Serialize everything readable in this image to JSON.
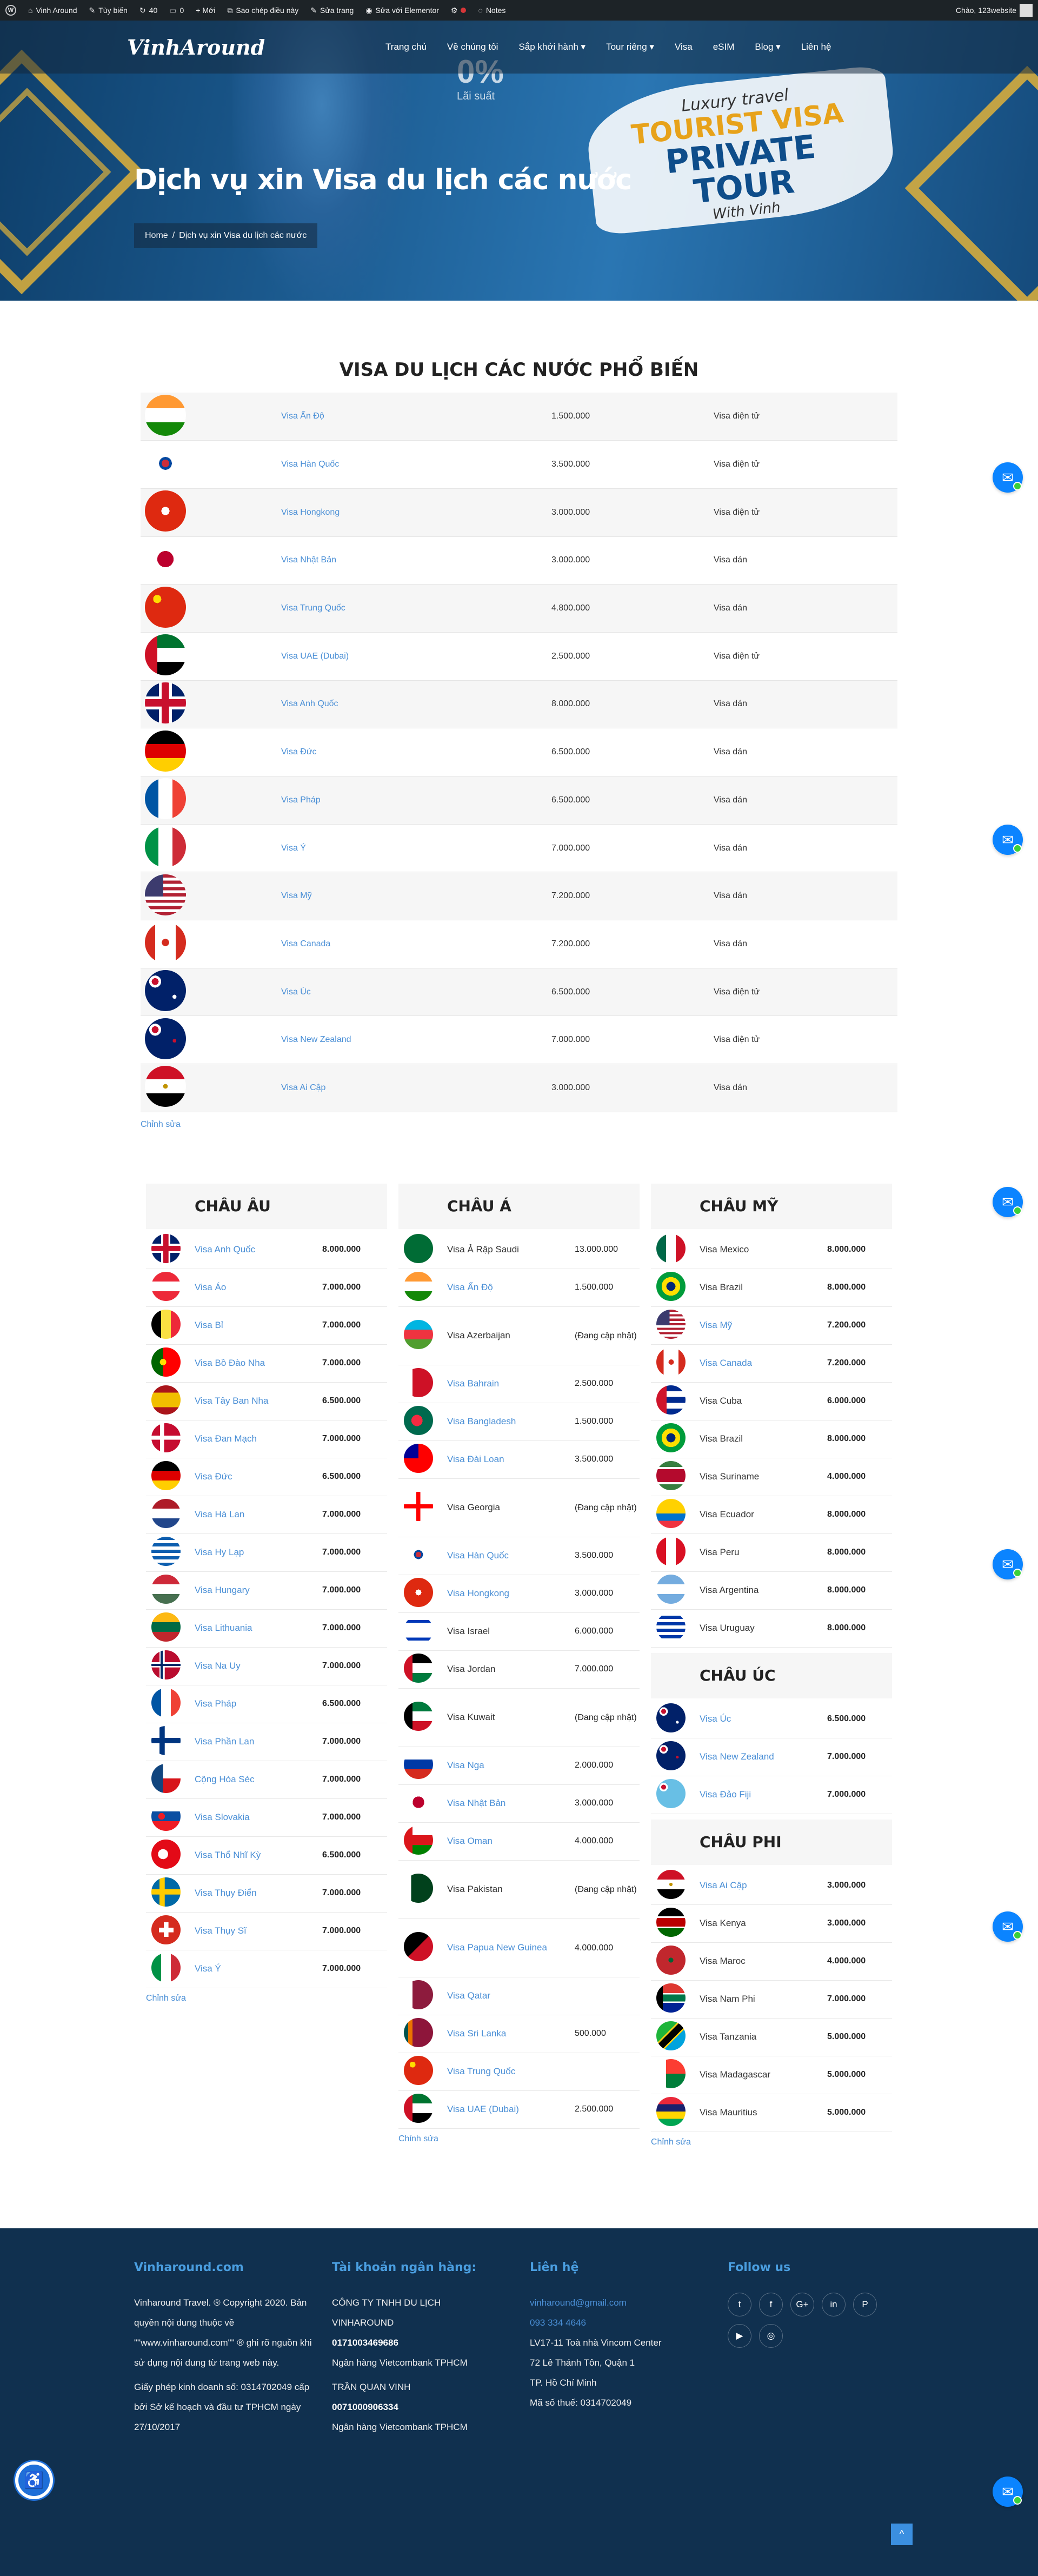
{
  "adminbar": {
    "site": "Vinh Around",
    "customize": "Tùy biến",
    "updates": "40",
    "comments": "0",
    "new": "+ Mới",
    "copy": "Sao chép điều này",
    "edit": "Sửa trang",
    "elementor": "Sửa với Elementor",
    "notes": "Notes",
    "greeting": "Chào, 123website"
  },
  "nav": {
    "logo": "VinhAround",
    "items": [
      "Trang chủ",
      "Về chúng tôi",
      "Sắp khởi hành ▾",
      "Tour riêng ▾",
      "Visa",
      "eSIM",
      "Blog ▾",
      "Liên hệ"
    ]
  },
  "hero": {
    "title": "Dịch vụ xin Visa du lịch các nước",
    "crumb_home": "Home",
    "crumb_sep": "/",
    "crumb_current": "Dịch vụ xin Visa du lịch các nước",
    "promo_1": "Luxury travel",
    "promo_2": "TOURIST VISA",
    "promo_3": "PRIVATE TOUR",
    "promo_4": "With Vinh",
    "pct": "0%",
    "pct_sub": "Lãi suất"
  },
  "popular": {
    "title": "VISA DU LỊCH CÁC NƯỚC PHỔ BIẾN",
    "edit": "Chỉnh sửa",
    "rows": [
      {
        "flag": "in",
        "name": "Visa Ấn Độ",
        "price": "1.500.000",
        "type": "Visa điện tử"
      },
      {
        "flag": "kr",
        "name": "Visa Hàn Quốc",
        "price": "3.500.000",
        "type": "Visa điện tử"
      },
      {
        "flag": "hk",
        "name": "Visa Hongkong",
        "price": "3.000.000",
        "type": "Visa điện tử"
      },
      {
        "flag": "jp",
        "name": "Visa Nhật Bản",
        "price": "3.000.000",
        "type": "Visa dán"
      },
      {
        "flag": "cn",
        "name": "Visa Trung Quốc",
        "price": "4.800.000",
        "type": "Visa dán"
      },
      {
        "flag": "ae",
        "name": "Visa UAE (Dubai)",
        "price": "2.500.000",
        "type": "Visa điện tử"
      },
      {
        "flag": "gb",
        "name": "Visa Anh Quốc",
        "price": "8.000.000",
        "type": "Visa dán"
      },
      {
        "flag": "de",
        "name": "Visa Đức",
        "price": "6.500.000",
        "type": "Visa dán"
      },
      {
        "flag": "fr",
        "name": "Visa Pháp",
        "price": "6.500.000",
        "type": "Visa dán"
      },
      {
        "flag": "it",
        "name": "Visa Ý",
        "price": "7.000.000",
        "type": "Visa dán"
      },
      {
        "flag": "us",
        "name": "Visa Mỹ",
        "price": "7.200.000",
        "type": "Visa dán"
      },
      {
        "flag": "ca",
        "name": "Visa Canada",
        "price": "7.200.000",
        "type": "Visa dán"
      },
      {
        "flag": "au",
        "name": "Visa Úc",
        "price": "6.500.000",
        "type": "Visa điện tử"
      },
      {
        "flag": "nz",
        "name": "Visa New Zealand",
        "price": "7.000.000",
        "type": "Visa điện tử"
      },
      {
        "flag": "eg",
        "name": "Visa Ai Cập",
        "price": "3.000.000",
        "type": "Visa dán"
      }
    ]
  },
  "europe": {
    "title": "CHÂU ÂU",
    "edit": "Chỉnh sửa",
    "rows": [
      {
        "flag": "gb",
        "name": "Visa Anh Quốc",
        "price": "8.000.000",
        "link": true
      },
      {
        "flag": "at",
        "name": "Visa Áo",
        "price": "7.000.000",
        "link": true
      },
      {
        "flag": "be",
        "name": "Visa Bỉ",
        "price": "7.000.000",
        "link": true
      },
      {
        "flag": "pt",
        "name": "Visa Bồ Đào Nha",
        "price": "7.000.000",
        "link": true
      },
      {
        "flag": "es",
        "name": "Visa Tây Ban Nha",
        "price": "6.500.000",
        "link": true
      },
      {
        "flag": "dk",
        "name": "Visa Đan Mạch",
        "price": "7.000.000",
        "link": true
      },
      {
        "flag": "de",
        "name": "Visa Đức",
        "price": "6.500.000",
        "link": true
      },
      {
        "flag": "nl",
        "name": "Visa Hà Lan",
        "price": "7.000.000",
        "link": true
      },
      {
        "flag": "gr",
        "name": "Visa Hy Lạp",
        "price": "7.000.000",
        "link": true
      },
      {
        "flag": "hu",
        "name": "Visa Hungary",
        "price": "7.000.000",
        "link": true
      },
      {
        "flag": "lt",
        "name": "Visa Lithuania",
        "price": "7.000.000",
        "link": true
      },
      {
        "flag": "no",
        "name": "Visa Na Uy",
        "price": "7.000.000",
        "link": true
      },
      {
        "flag": "fr",
        "name": "Visa Pháp",
        "price": "6.500.000",
        "link": true
      },
      {
        "flag": "fi",
        "name": "Visa Phần Lan",
        "price": "7.000.000",
        "link": true
      },
      {
        "flag": "cz",
        "name": "Cộng Hòa Séc",
        "price": "7.000.000",
        "link": true
      },
      {
        "flag": "sk",
        "name": "Visa Slovakia",
        "price": "7.000.000",
        "link": true
      },
      {
        "flag": "tr",
        "name": "Visa Thổ Nhĩ Kỳ",
        "price": "6.500.000",
        "link": true
      },
      {
        "flag": "se",
        "name": "Visa Thụy Điển",
        "price": "7.000.000",
        "link": true
      },
      {
        "flag": "ch",
        "name": "Visa Thụy Sĩ",
        "price": "7.000.000",
        "link": true
      },
      {
        "flag": "it",
        "name": "Visa Ý",
        "price": "7.000.000",
        "link": true
      }
    ]
  },
  "asia": {
    "title": "CHÂU Á",
    "edit": "Chỉnh sửa",
    "rows": [
      {
        "flag": "sa",
        "name": "Visa Ả Rập Saudi",
        "price": "13.000.000",
        "link": false
      },
      {
        "flag": "in",
        "name": "Visa Ấn Độ",
        "price": "1.500.000",
        "link": true
      },
      {
        "flag": "az",
        "name": "Visa Azerbaijan",
        "price": "(Đang cập nhật)",
        "link": false,
        "tall": true
      },
      {
        "flag": "bh",
        "name": "Visa Bahrain",
        "price": "2.500.000",
        "link": true
      },
      {
        "flag": "bd",
        "name": "Visa Bangladesh",
        "price": "1.500.000",
        "link": true
      },
      {
        "flag": "tw",
        "name": "Visa Đài Loan",
        "price": "3.500.000",
        "link": true
      },
      {
        "flag": "ge",
        "name": "Visa Georgia",
        "price": "(Đang cập nhật)",
        "link": false,
        "tall": true
      },
      {
        "flag": "kr",
        "name": "Visa Hàn Quốc",
        "price": "3.500.000",
        "link": true
      },
      {
        "flag": "hk",
        "name": "Visa Hongkong",
        "price": "3.000.000",
        "link": true
      },
      {
        "flag": "il",
        "name": "Visa Israel",
        "price": "6.000.000",
        "link": false
      },
      {
        "flag": "jo",
        "name": "Visa Jordan",
        "price": "7.000.000",
        "link": false
      },
      {
        "flag": "kw",
        "name": "Visa Kuwait",
        "price": "(Đang cập nhật)",
        "link": false,
        "tall": true
      },
      {
        "flag": "ru",
        "name": "Visa Nga",
        "price": "2.000.000",
        "link": true
      },
      {
        "flag": "jp",
        "name": "Visa Nhật Bản",
        "price": "3.000.000",
        "link": true
      },
      {
        "flag": "om",
        "name": "Visa Oman",
        "price": "4.000.000",
        "link": true
      },
      {
        "flag": "pk",
        "name": "Visa Pakistan",
        "price": "(Đang cập nhật)",
        "link": false,
        "tall": true
      },
      {
        "flag": "pg",
        "name": "Visa Papua New Guinea",
        "price": "4.000.000",
        "link": true,
        "tall": true
      },
      {
        "flag": "qa",
        "name": "Visa Qatar",
        "price": "",
        "link": true
      },
      {
        "flag": "lk",
        "name": "Visa Sri Lanka",
        "price": "500.000",
        "link": true
      },
      {
        "flag": "cn",
        "name": "Visa Trung Quốc",
        "price": "",
        "link": true
      },
      {
        "flag": "ae",
        "name": "Visa UAE (Dubai)",
        "price": "2.500.000",
        "link": true
      }
    ]
  },
  "america": {
    "title": "CHÂU MỸ",
    "rows": [
      {
        "flag": "mx",
        "name": "Visa Mexico",
        "price": "8.000.000",
        "link": false
      },
      {
        "flag": "br",
        "name": "Visa Brazil",
        "price": "8.000.000",
        "link": false
      },
      {
        "flag": "us",
        "name": "Visa Mỹ",
        "price": "7.200.000",
        "link": true
      },
      {
        "flag": "ca",
        "name": "Visa Canada",
        "price": "7.200.000",
        "link": true
      },
      {
        "flag": "cu",
        "name": "Visa Cuba",
        "price": "6.000.000",
        "link": false
      },
      {
        "flag": "br",
        "name": "Visa Brazil",
        "price": "8.000.000",
        "link": false
      },
      {
        "flag": "sr",
        "name": "Visa Suriname",
        "price": "4.000.000",
        "link": false
      },
      {
        "flag": "ec",
        "name": "Visa Ecuador",
        "price": "8.000.000",
        "link": false
      },
      {
        "flag": "pe",
        "name": "Visa Peru",
        "price": "8.000.000",
        "link": false
      },
      {
        "flag": "ar",
        "name": "Visa Argentina",
        "price": "8.000.000",
        "link": false
      },
      {
        "flag": "uy",
        "name": "Visa Uruguay",
        "price": "8.000.000",
        "link": false
      }
    ]
  },
  "oceania": {
    "title": "CHÂU ÚC",
    "rows": [
      {
        "flag": "au",
        "name": "Visa Úc",
        "price": "6.500.000",
        "link": true
      },
      {
        "flag": "nz",
        "name": "Visa New Zealand",
        "price": "7.000.000",
        "link": true
      },
      {
        "flag": "fj",
        "name": "Visa Đảo Fiji",
        "price": "7.000.000",
        "link": true
      }
    ]
  },
  "africa": {
    "title": "CHÂU PHI",
    "edit": "Chỉnh sửa",
    "rows": [
      {
        "flag": "eg",
        "name": "Visa Ai Cập",
        "price": "3.000.000",
        "link": true
      },
      {
        "flag": "ke",
        "name": "Visa Kenya",
        "price": "3.000.000",
        "link": false
      },
      {
        "flag": "ma",
        "name": "Visa Maroc",
        "price": "4.000.000",
        "link": false
      },
      {
        "flag": "za",
        "name": "Visa Nam Phi",
        "price": "7.000.000",
        "link": false
      },
      {
        "flag": "tz",
        "name": "Visa Tanzania",
        "price": "5.000.000",
        "link": false
      },
      {
        "flag": "mg",
        "name": "Visa Madagascar",
        "price": "5.000.000",
        "link": false
      },
      {
        "flag": "mu",
        "name": "Visa Mauritius",
        "price": "5.000.000",
        "link": false
      }
    ]
  },
  "footer": {
    "c1": {
      "title": "Vinharound.com",
      "p1": "Vinharound Travel. ® Copyright 2020. Bản quyền nội dung thuộc về \"\"www.vinharound.com\"\" ® ghi rõ nguồn khi sử dụng nội dung từ trang web này.",
      "p2": "Giấy phép kinh doanh số: 0314702049 cấp bởi Sở kế hoạch và đầu tư TPHCM ngày 27/10/2017"
    },
    "c2": {
      "title": "Tài khoản ngân hàng:",
      "company": "CÔNG TY TNHH DU LỊCH VINHAROUND",
      "acc1": "0171003469686",
      "bank1": "Ngân hàng Vietcombank TPHCM",
      "owner": "TRẦN QUAN VINH",
      "acc2": "0071000906334",
      "bank2": "Ngân hàng Vietcombank TPHCM"
    },
    "c3": {
      "title": "Liên hệ",
      "email": "vinharound@gmail.com",
      "phone": "093 334 4646",
      "addr1": "LV17-11 Toà nhà Vincom Center",
      "addr2": "72 Lê Thánh Tôn, Quận 1",
      "addr3": "TP. Hồ Chí Minh",
      "tax": "Mã số thuế: 0314702049"
    },
    "c4": {
      "title": "Follow us"
    }
  }
}
